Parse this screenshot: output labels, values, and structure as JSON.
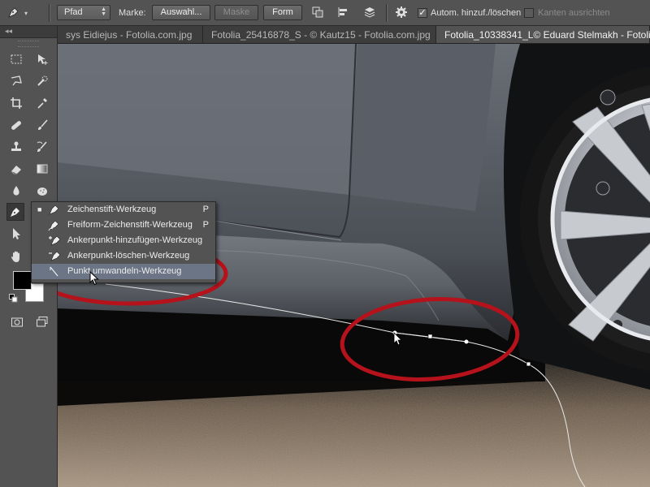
{
  "options_bar": {
    "mode_value": "Pfad",
    "marke_label": "Marke:",
    "auswahl_button": "Auswahl...",
    "maske_button": "Maske",
    "form_button": "Form",
    "auto_add_delete_label": "Autom. hinzuf./löschen",
    "auto_add_delete_checked": true,
    "align_edges_label": "Kanten ausrichten",
    "align_edges_checked": false
  },
  "toolbar": {
    "collapse_glyph": "◂◂",
    "tools": [
      "rectangular-marquee",
      "move",
      "lasso",
      "quick-selection",
      "crop",
      "eyedropper",
      "spot-healing-brush",
      "brush",
      "clone-stamp",
      "history-brush",
      "eraser",
      "gradient",
      "blur",
      "dodge",
      "pen",
      "type",
      "path-selection",
      "shape",
      "hand",
      "zoom"
    ],
    "active_tool": "pen",
    "foreground_color": "#000000",
    "background_color": "#ffffff"
  },
  "tabs": [
    {
      "label": "sys Eidiejus - Fotolia.com.jpg",
      "active": false
    },
    {
      "label": "Fotolia_25416878_S - © Kautz15 - Fotolia.com.jpg",
      "active": false
    },
    {
      "label": "Fotolia_10338341_L© Eduard Stelmakh - Fotolia.com.jpg",
      "active": true
    }
  ],
  "flyout": {
    "items": [
      {
        "label": "Zeichenstift-Werkzeug",
        "shortcut": "P",
        "selected": true,
        "icon": "pen-icon"
      },
      {
        "label": "Freiform-Zeichenstift-Werkzeug",
        "shortcut": "P",
        "selected": false,
        "icon": "freeform-pen-icon"
      },
      {
        "label": "Ankerpunkt-hinzufügen-Werkzeug",
        "shortcut": "",
        "selected": false,
        "icon": "add-anchor-icon"
      },
      {
        "label": "Ankerpunkt-löschen-Werkzeug",
        "shortcut": "",
        "selected": false,
        "icon": "delete-anchor-icon"
      },
      {
        "label": "Punkt umwandeln-Werkzeug",
        "shortcut": "",
        "selected": false,
        "icon": "convert-point-icon",
        "hover": true
      }
    ]
  },
  "colors": {
    "annotation_red": "#b5121b",
    "ui_dark": "#535353",
    "hover_highlight": "#6b7585"
  }
}
